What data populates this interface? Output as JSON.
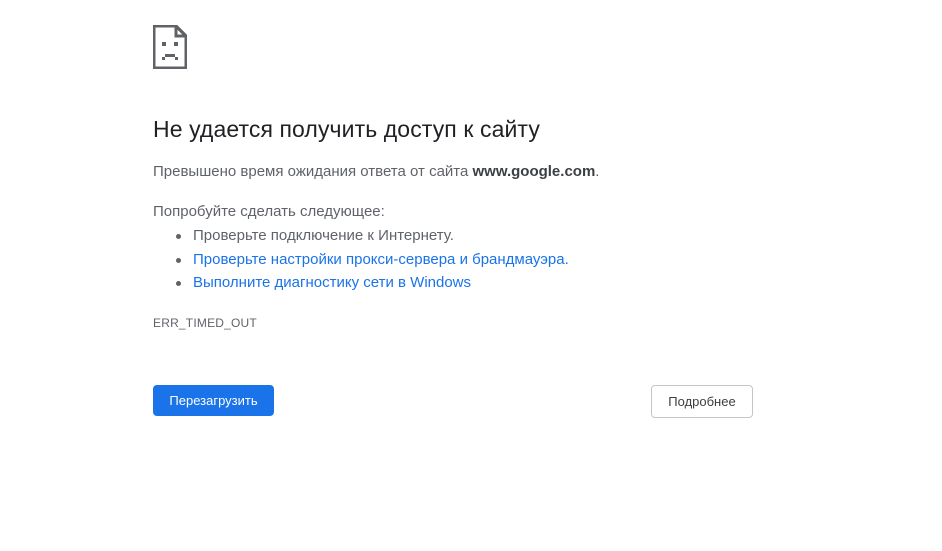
{
  "icon": "sad-page-icon",
  "title": "Не удается получить доступ к сайту",
  "message": {
    "prefix": "Превышено время ожидания ответа от сайта ",
    "host": "www.google.com",
    "suffix": "."
  },
  "try_heading": "Попробуйте сделать следующее:",
  "suggestions": [
    {
      "text": "Проверьте подключение к Интернету.",
      "is_link": false
    },
    {
      "text": "Проверьте настройки прокси-сервера и брандмауэра.",
      "is_link": true
    },
    {
      "text": "Выполните диагностику сети в Windows",
      "is_link": true
    }
  ],
  "error_code": "ERR_TIMED_OUT",
  "buttons": {
    "reload": "Перезагрузить",
    "details": "Подробнее"
  },
  "colors": {
    "accent": "#1a73e8",
    "text": "#202124",
    "secondary_text": "#5f6368"
  }
}
